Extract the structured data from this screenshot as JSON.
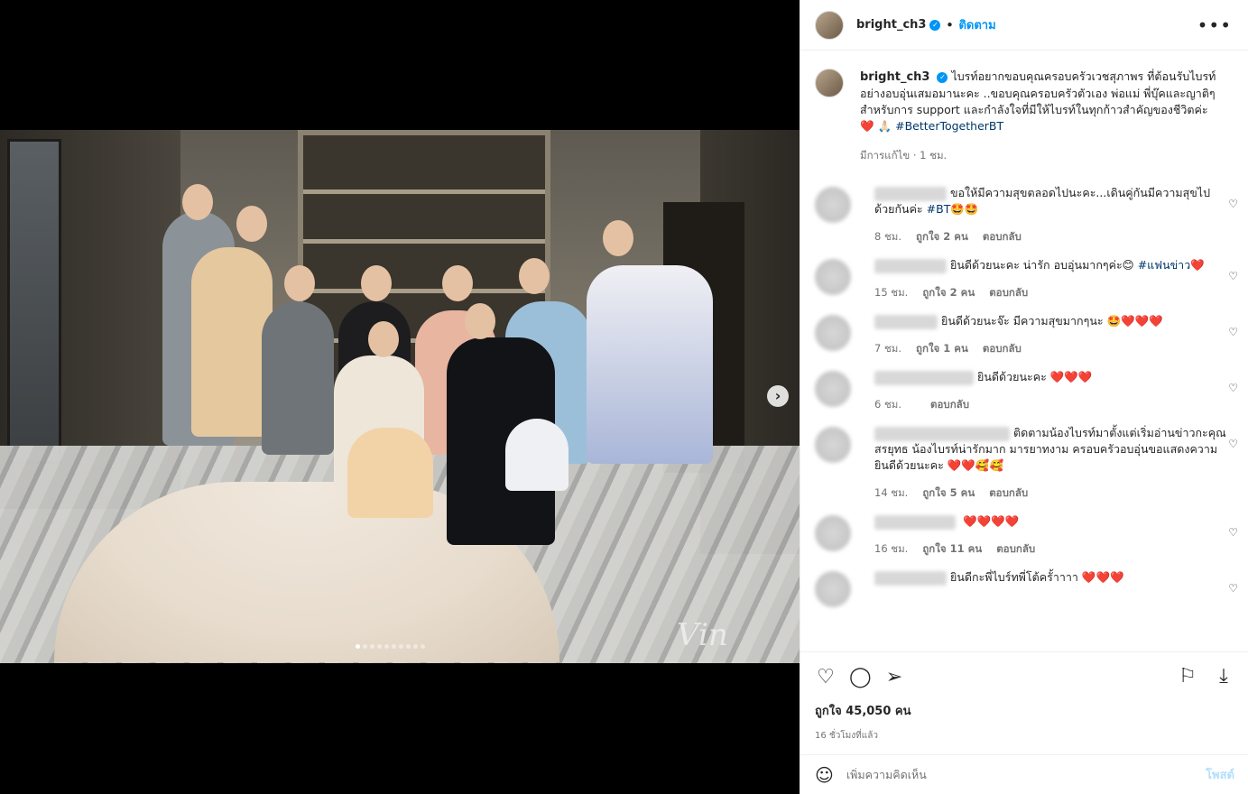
{
  "post": {
    "username": "bright_ch3",
    "follow_label": "ติดตาม",
    "caption_text": "ไบรท์อยากขอบคุณครอบครัวเวชสุภาพร ที่ต้อนรับไบรท์อย่างอบอุ่นเสมอมานะคะ ..ขอบคุณครอบครัวตัวเอง พ่อแม่ พี่บุ๊คและญาติๆ สำหรับการ support และกำลังใจที่มีให้ไบรท์ในทุกก้าวสำคัญของชีวิตค่ะ",
    "caption_emoji": "❤️ 🙏🏻",
    "hashtag": "#BetterTogetherBT",
    "edited_label": "มีการแก้ไข · 1 ชม.",
    "likes_label": "ถูกใจ 45,050 คน",
    "time_ago": "16 ชั่วโมงที่แล้ว",
    "add_comment_placeholder": "เพิ่มความคิดเห็น",
    "post_button": "โพสต์"
  },
  "comments": [
    {
      "text": "ขอให้มีความสุขตลอดไปนะคะ...เดินคู่กันมีความสุขไปด้วยกันค่ะ",
      "tag": "#BT",
      "emoji": "🤩🤩",
      "time": "8 ชม.",
      "likes": "ถูกใจ 2 คน",
      "reply": "ตอบกลับ"
    },
    {
      "text": "ยินดีด้วยนะคะ น่ารัก อบอุ่นมากๆค่ะ😊",
      "tag": "#แฟนข่าว",
      "emoji": "❤️",
      "time": "15 ชม.",
      "likes": "ถูกใจ 2 คน",
      "reply": "ตอบกลับ"
    },
    {
      "text": "ยินดีด้วยนะจ๊ะ มีความสุขมากๆนะ",
      "tag": "",
      "emoji": "🤩❤️❤️❤️",
      "time": "7 ชม.",
      "likes": "ถูกใจ 1 คน",
      "reply": "ตอบกลับ"
    },
    {
      "text": "ยินดีด้วยนะคะ",
      "tag": "",
      "emoji": "❤️❤️❤️",
      "time": "6 ชม.",
      "likes": "",
      "reply": "ตอบกลับ"
    },
    {
      "text": "ติดตามน้องไบรท์มาตั้งแต่เริ่มอ่านข่าวกะคุณสรยุทธ น้องไบรท์น่ารักมาก มารยาทงาม ครอบครัวอบอุ่นขอแสดงความยินดีด้วยนะคะ",
      "tag": "",
      "emoji": "❤️❤️🥰🥰",
      "time": "14 ชม.",
      "likes": "ถูกใจ 5 คน",
      "reply": "ตอบกลับ"
    },
    {
      "text": "",
      "tag": "",
      "emoji": "❤️❤️❤️❤️",
      "time": "16 ชม.",
      "likes": "ถูกใจ 11 คน",
      "reply": "ตอบกลับ"
    },
    {
      "text": "ยินดีกะพี่ไบร์ทพี่โต้ครั้าาาา",
      "tag": "",
      "emoji": "❤️❤️❤️",
      "time": "",
      "likes": "",
      "reply": ""
    }
  ],
  "icons": {
    "more": "more-options-icon",
    "next": "chevron-right-icon",
    "like": "heart-icon",
    "comment": "comment-icon",
    "share": "send-icon",
    "save": "bookmark-icon",
    "download": "download-icon",
    "emoji": "emoji-icon"
  },
  "carousel": {
    "total": 10,
    "active": 1
  },
  "colors": {
    "accent": "#0095f6",
    "link": "#00376b",
    "muted": "#737373",
    "heart": "#ed4956"
  }
}
